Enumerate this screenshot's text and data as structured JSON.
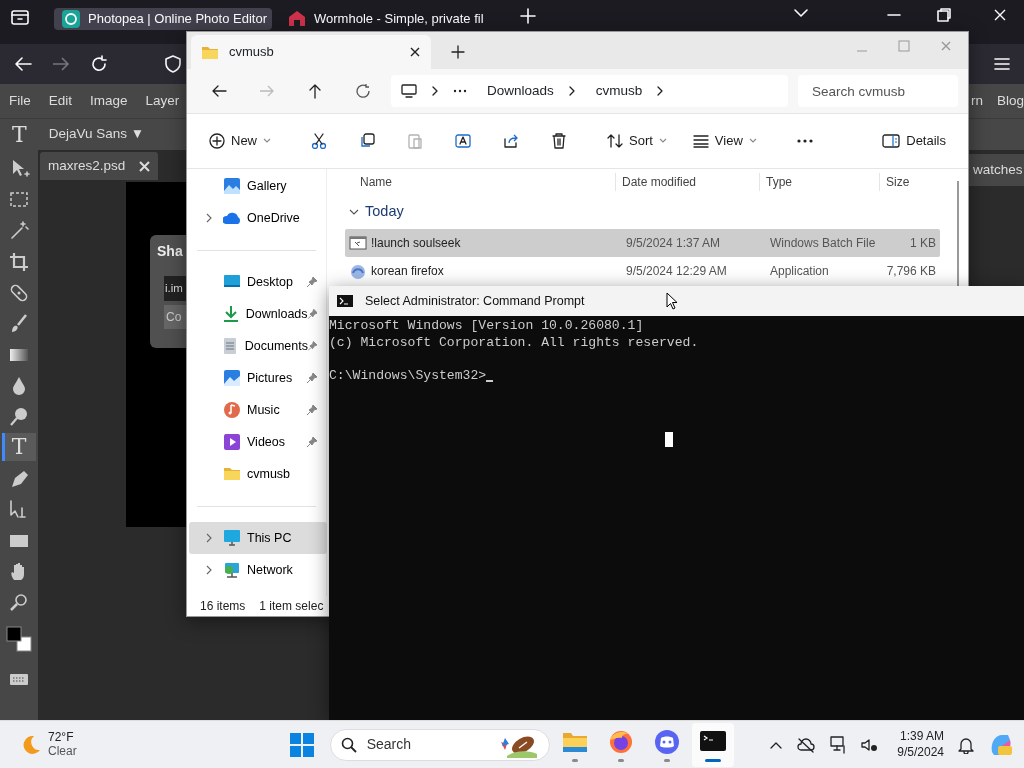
{
  "browser": {
    "tabs": [
      {
        "title": "Photopea | Online Photo Editor",
        "selected": true
      },
      {
        "title": "Wormhole - Simple, private fil",
        "selected": false
      }
    ]
  },
  "photopea": {
    "menu": [
      "File",
      "Edit",
      "Image",
      "Layer"
    ],
    "menu_right": [
      "rn",
      "Blog"
    ],
    "tool_glyph": "T",
    "font_select": "DejaVu Sans ▼",
    "document_tab": "maxres2.psd",
    "dialog": {
      "title": "Sha",
      "field": "i.im",
      "button": "Co"
    },
    "panel_tab": "watches",
    "tools": [
      {
        "kind": "move",
        "selected": false
      },
      {
        "kind": "marquee",
        "selected": false
      },
      {
        "kind": "wand",
        "selected": false
      },
      {
        "kind": "crop",
        "selected": false
      },
      {
        "kind": "heal",
        "selected": false
      },
      {
        "kind": "brush",
        "selected": false
      },
      {
        "kind": "gradient",
        "selected": false
      },
      {
        "kind": "blur",
        "selected": false
      },
      {
        "kind": "dodge",
        "selected": false
      },
      {
        "kind": "type",
        "glyph": "T",
        "selected": true
      },
      {
        "kind": "pen",
        "selected": false
      },
      {
        "kind": "path",
        "selected": false
      },
      {
        "kind": "shape",
        "selected": false
      },
      {
        "kind": "hand",
        "selected": false
      },
      {
        "kind": "zoom",
        "selected": false
      }
    ]
  },
  "explorer": {
    "tab": "cvmusb",
    "breadcrumb": [
      "Downloads",
      "cvmusb"
    ],
    "search": {
      "placeholder": "Search cvmusb"
    },
    "commands": [
      {
        "kind": "new",
        "label": "New",
        "disabled": false
      },
      {
        "kind": "cut",
        "disabled": false
      },
      {
        "kind": "copy",
        "disabled": false
      },
      {
        "kind": "paste",
        "disabled": true
      },
      {
        "kind": "rename",
        "disabled": false
      },
      {
        "kind": "share",
        "disabled": false
      },
      {
        "kind": "delete",
        "disabled": false
      },
      {
        "kind": "sort",
        "label": "Sort",
        "disabled": false
      },
      {
        "kind": "view",
        "label": "View",
        "disabled": false
      },
      {
        "kind": "more",
        "disabled": false
      }
    ],
    "details": "Details",
    "nav": [
      [
        {
          "label": "Gallery",
          "kind": "gallery",
          "expandable": false,
          "pinned": false,
          "selected": false
        },
        {
          "label": "OneDrive",
          "kind": "onedrive",
          "expandable": true,
          "pinned": false,
          "selected": false
        }
      ],
      [
        {
          "label": "Desktop",
          "kind": "desktop",
          "expandable": false,
          "pinned": true,
          "selected": false
        },
        {
          "label": "Downloads",
          "kind": "downloads",
          "expandable": false,
          "pinned": true,
          "selected": false
        },
        {
          "label": "Documents",
          "kind": "documents",
          "expandable": false,
          "pinned": true,
          "selected": false
        },
        {
          "label": "Pictures",
          "kind": "pictures",
          "expandable": false,
          "pinned": true,
          "selected": false
        },
        {
          "label": "Music",
          "kind": "music",
          "expandable": false,
          "pinned": true,
          "selected": false
        },
        {
          "label": "Videos",
          "kind": "videos",
          "expandable": false,
          "pinned": true,
          "selected": false
        },
        {
          "label": "cvmusb",
          "kind": "folder",
          "expandable": false,
          "pinned": false,
          "selected": false
        }
      ],
      [
        {
          "label": "This PC",
          "kind": "pc",
          "expandable": true,
          "pinned": false,
          "selected": true
        },
        {
          "label": "Network",
          "kind": "network",
          "expandable": true,
          "pinned": false,
          "selected": false
        }
      ]
    ],
    "columns": [
      "Name",
      "Date modified",
      "Type",
      "Size"
    ],
    "group": "Today",
    "files": [
      {
        "name": "!launch soulseek",
        "kind": "batch",
        "date": "9/5/2024 1:37 AM",
        "type": "Windows Batch File",
        "size": "1 KB",
        "selected": true
      },
      {
        "name": "korean firefox",
        "kind": "app",
        "date": "9/5/2024 12:29 AM",
        "type": "Application",
        "size": "7,796 KB",
        "selected": false
      }
    ],
    "status": [
      "16 items",
      "1 item selec"
    ]
  },
  "console": {
    "title": "Select Administrator: Command Prompt",
    "lines": [
      "Microsoft Windows [Version 10.0.26080.1]",
      "(c) Microsoft Corporation. All rights reserved."
    ],
    "prompt": "C:\\Windows\\System32>"
  },
  "taskbar": {
    "weather": {
      "temperature": "72°F",
      "condition": "Clear"
    },
    "search": "Search",
    "apps": [
      {
        "kind": "explorer",
        "active": false
      },
      {
        "kind": "firefox",
        "active": false
      },
      {
        "kind": "discord",
        "active": false
      },
      {
        "kind": "terminal",
        "active": true
      }
    ],
    "time": "1:39 AM",
    "date": "9/5/2024"
  }
}
